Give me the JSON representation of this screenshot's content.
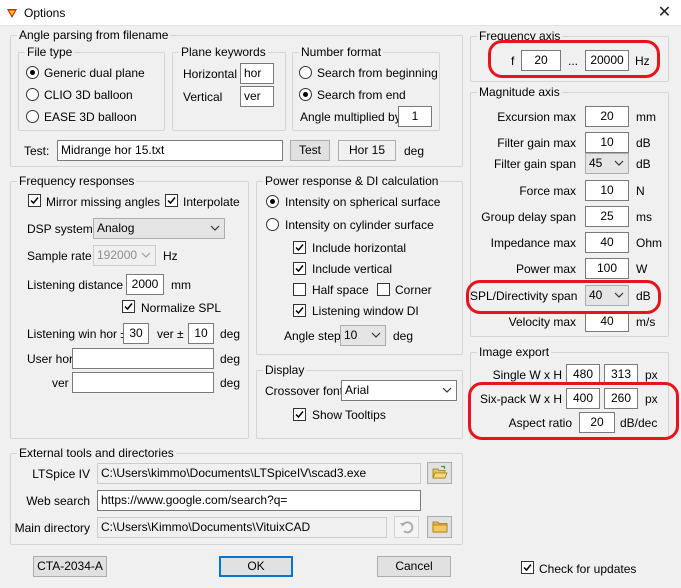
{
  "window": {
    "title": "Options",
    "close_glyph": "✕"
  },
  "angle_parsing": {
    "legend": "Angle parsing from filename",
    "file_type": {
      "legend": "File type",
      "options": [
        "Generic dual plane",
        "CLIO 3D balloon",
        "EASE 3D balloon"
      ],
      "selected": 0
    },
    "plane_keywords": {
      "legend": "Plane keywords",
      "horizontal_label": "Horizontal",
      "horizontal_value": "hor",
      "vertical_label": "Vertical",
      "vertical_value": "ver"
    },
    "number_format": {
      "legend": "Number format",
      "options": [
        "Search from beginning",
        "Search from end"
      ],
      "selected": 1,
      "multiplier_label": "Angle multiplied by",
      "multiplier_value": "1"
    },
    "test": {
      "label": "Test:",
      "value": "Midrange hor 15.txt",
      "button": "Test",
      "result": "Hor 15",
      "unit": "deg"
    }
  },
  "frequency_responses": {
    "legend": "Frequency responses",
    "mirror_label": "Mirror missing angles",
    "interpolate_label": "Interpolate",
    "dsp_label": "DSP system",
    "dsp_value": "Analog",
    "sample_rate_label": "Sample rate",
    "sample_rate_value": "192000",
    "sample_rate_unit": "Hz",
    "listening_distance_label": "Listening distance",
    "listening_distance_value": "2000",
    "listening_distance_unit": "mm",
    "normalize_label": "Normalize SPL",
    "win_hor_label": "Listening win hor ±",
    "win_hor_value": "30",
    "win_ver_label": "ver ±",
    "win_ver_value": "10",
    "win_unit": "deg",
    "user_hor_label": "User hor",
    "user_hor_value": "",
    "user_hor_unit": "deg",
    "user_ver_label": "ver",
    "user_ver_value": "",
    "user_ver_unit": "deg"
  },
  "power_response": {
    "legend": "Power response & DI calculation",
    "options": [
      "Intensity on spherical surface",
      "Intensity on cylinder surface"
    ],
    "selected": 0,
    "include_horizontal": "Include horizontal",
    "include_vertical": "Include vertical",
    "half_space": "Half space",
    "corner": "Corner",
    "listening_window_di": "Listening window DI",
    "angle_step_label": "Angle step",
    "angle_step_value": "10",
    "angle_step_unit": "deg"
  },
  "display": {
    "legend": "Display",
    "crossover_font_label": "Crossover font",
    "crossover_font_value": "Arial",
    "show_tooltips": "Show Tooltips"
  },
  "external_tools": {
    "legend": "External tools and directories",
    "ltspice_label": "LTSpice IV",
    "ltspice_value": "C:\\Users\\kimmo\\Documents\\LTSpiceIV\\scad3.exe",
    "web_search_label": "Web search",
    "web_search_value": "https://www.google.com/search?q=",
    "main_dir_label": "Main directory",
    "main_dir_value": "C:\\Users\\Kimmo\\Documents\\VituixCAD"
  },
  "frequency_axis": {
    "legend": "Frequency axis",
    "f_label": "f",
    "f_min": "20",
    "sep": "...",
    "f_max": "20000",
    "unit": "Hz"
  },
  "magnitude_axis": {
    "legend": "Magnitude axis",
    "rows": [
      {
        "label": "Excursion max",
        "value": "20",
        "unit": "mm",
        "kind": "input"
      },
      {
        "label": "Filter gain max",
        "value": "10",
        "unit": "dB",
        "kind": "input"
      },
      {
        "label": "Filter gain span",
        "value": "45",
        "unit": "dB",
        "kind": "select"
      },
      {
        "label": "Force max",
        "value": "10",
        "unit": "N",
        "kind": "input"
      },
      {
        "label": "Group delay span",
        "value": "25",
        "unit": "ms",
        "kind": "input"
      },
      {
        "label": "Impedance max",
        "value": "40",
        "unit": "Ohm",
        "kind": "input"
      },
      {
        "label": "Power max",
        "value": "100",
        "unit": "W",
        "kind": "input"
      },
      {
        "label": "SPL/Directivity span",
        "value": "40",
        "unit": "dB",
        "kind": "select"
      },
      {
        "label": "Velocity max",
        "value": "40",
        "unit": "m/s",
        "kind": "input"
      }
    ]
  },
  "image_export": {
    "legend": "Image export",
    "single_label": "Single W x H",
    "single_w": "480",
    "single_h": "313",
    "single_unit": "px",
    "sixpack_label": "Six-pack W x H",
    "sixpack_w": "400",
    "sixpack_h": "260",
    "sixpack_unit": "px",
    "aspect_label": "Aspect ratio",
    "aspect_value": "20",
    "aspect_unit": "dB/dec"
  },
  "footer": {
    "cta_button": "CTA-2034-A",
    "ok_button": "OK",
    "cancel_button": "Cancel",
    "check_updates": "Check for updates"
  },
  "colors": {
    "highlight": "#e8141c",
    "focus": "#0078d7"
  }
}
